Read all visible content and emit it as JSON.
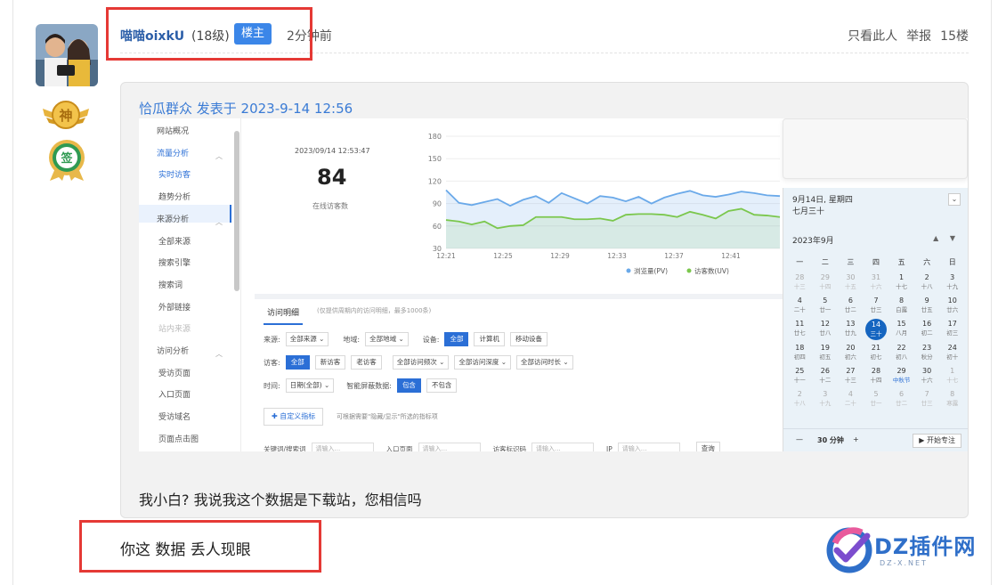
{
  "post": {
    "username": "喵喵oixkU",
    "level": "(18级)",
    "op_badge": "楼主",
    "time": "2分钟前",
    "actions": {
      "only_author": "只看此人",
      "report": "举报",
      "floor": "15楼"
    }
  },
  "quote": {
    "header": "恰瓜群众 发表于 2023-9-14 12:56",
    "text": "我小白? 我说我这个数据是下载站，您相信吗"
  },
  "reply": {
    "text": "你这 数据 丢人现眼"
  },
  "watermark": {
    "title": "DZ插件网",
    "sub": "DZ-X.NET"
  },
  "medals": {
    "shen": "神",
    "qian": "签"
  },
  "screenshot": {
    "sidebar": [
      {
        "label": "网站概况",
        "type": "top"
      },
      {
        "label": "流量分析",
        "type": "top-active"
      },
      {
        "label": "实时访客",
        "type": "sub-active"
      },
      {
        "label": "趋势分析",
        "type": "sub"
      },
      {
        "label": "来源分析",
        "type": "top"
      },
      {
        "label": "全部来源",
        "type": "sub"
      },
      {
        "label": "搜索引擎",
        "type": "sub"
      },
      {
        "label": "搜索词",
        "type": "sub"
      },
      {
        "label": "外部链接",
        "type": "sub"
      },
      {
        "label": "站内来源",
        "type": "sub-dim"
      },
      {
        "label": "访问分析",
        "type": "top"
      },
      {
        "label": "受访页面",
        "type": "sub"
      },
      {
        "label": "入口页面",
        "type": "sub"
      },
      {
        "label": "受访域名",
        "type": "sub"
      },
      {
        "label": "页面点击图",
        "type": "sub"
      }
    ],
    "stat": {
      "time": "2023/09/14 12:53:47",
      "value": "84",
      "label": "在线访客数"
    },
    "tabs": {
      "active": "访问明细",
      "note": "(仅提供周期内的访问明细，最多1000条)"
    },
    "filters": {
      "source_label": "来源:",
      "source_value": "全部来源",
      "region_label": "地域:",
      "region_value": "全部地域",
      "device_label": "设备:",
      "device_options": [
        "全部",
        "计算机",
        "移动设备"
      ],
      "visitor_label": "访客:",
      "visitor_options": [
        "全部",
        "新访客",
        "老访客"
      ],
      "freq_value": "全部访问频次",
      "depth_value": "全部访问深度",
      "duration_value": "全部访问时长",
      "time_label": "时间:",
      "time_value": "日期(全部)",
      "smart_label": "智能屏蔽数据:",
      "smart_options": [
        "包含",
        "不包含"
      ]
    },
    "custom_button": "自定义指标",
    "custom_note": "可根据需要\"隐藏/显示\"所选的指标项",
    "search": {
      "kw_label": "关键词/搜索词",
      "kw_ph": "请输入...",
      "entry_label": "入口页面",
      "entry_ph": "请输入...",
      "visitor_label": "访客标识码",
      "visitor_ph": "请输入...",
      "ip_label": "IP",
      "ip_ph": "请输入...",
      "query_btn": "查询"
    },
    "calendar": {
      "date_line": "9月14日, 星期四",
      "lunar_line": "七月三十",
      "month": "2023年9月",
      "weekdays": [
        "一",
        "二",
        "三",
        "四",
        "五",
        "六",
        "日"
      ],
      "days": [
        {
          "d": "28",
          "l": "十三",
          "o": true
        },
        {
          "d": "29",
          "l": "十四",
          "o": true
        },
        {
          "d": "30",
          "l": "十五",
          "o": true
        },
        {
          "d": "31",
          "l": "十六",
          "o": true
        },
        {
          "d": "1",
          "l": "十七"
        },
        {
          "d": "2",
          "l": "十八"
        },
        {
          "d": "3",
          "l": "十九"
        },
        {
          "d": "4",
          "l": "二十"
        },
        {
          "d": "5",
          "l": "廿一"
        },
        {
          "d": "6",
          "l": "廿二"
        },
        {
          "d": "7",
          "l": "廿三"
        },
        {
          "d": "8",
          "l": "白露"
        },
        {
          "d": "9",
          "l": "廿五"
        },
        {
          "d": "10",
          "l": "廿六"
        },
        {
          "d": "11",
          "l": "廿七"
        },
        {
          "d": "12",
          "l": "廿八"
        },
        {
          "d": "13",
          "l": "廿九"
        },
        {
          "d": "14",
          "l": "三十",
          "t": true
        },
        {
          "d": "15",
          "l": "八月"
        },
        {
          "d": "16",
          "l": "初二"
        },
        {
          "d": "17",
          "l": "初三"
        },
        {
          "d": "18",
          "l": "初四"
        },
        {
          "d": "19",
          "l": "初五"
        },
        {
          "d": "20",
          "l": "初六"
        },
        {
          "d": "21",
          "l": "初七"
        },
        {
          "d": "22",
          "l": "初八"
        },
        {
          "d": "23",
          "l": "秋分"
        },
        {
          "d": "24",
          "l": "初十"
        },
        {
          "d": "25",
          "l": "十一"
        },
        {
          "d": "26",
          "l": "十二"
        },
        {
          "d": "27",
          "l": "十三"
        },
        {
          "d": "28",
          "l": "十四"
        },
        {
          "d": "29",
          "l": "中秋节",
          "h": true
        },
        {
          "d": "30",
          "l": "十六"
        },
        {
          "d": "1",
          "l": "十七",
          "o": true
        },
        {
          "d": "2",
          "l": "十八",
          "o": true
        },
        {
          "d": "3",
          "l": "十九",
          "o": true
        },
        {
          "d": "4",
          "l": "二十",
          "o": true
        },
        {
          "d": "5",
          "l": "廿一",
          "o": true
        },
        {
          "d": "6",
          "l": "廿二",
          "o": true
        },
        {
          "d": "7",
          "l": "廿三",
          "o": true
        },
        {
          "d": "8",
          "l": "寒露",
          "o": true
        }
      ],
      "focus_minus": "—",
      "focus_value": "30 分钟",
      "focus_plus": "+",
      "focus_button": "▶ 开始专注"
    }
  },
  "chart_data": {
    "type": "area",
    "x": [
      "12:21",
      "12:25",
      "12:29",
      "12:33",
      "12:37",
      "12:41"
    ],
    "ylim": [
      30,
      180
    ],
    "yticks": [
      30,
      60,
      90,
      120,
      150,
      180
    ],
    "legend_placement": "bottom",
    "series": [
      {
        "name": "浏览量(PV)",
        "color": "#6aa9e9",
        "values": [
          108,
          91,
          88,
          92,
          96,
          87,
          95,
          100,
          91,
          104,
          97,
          90,
          100,
          98,
          93,
          99,
          90,
          98,
          103,
          107,
          101,
          99,
          102,
          106,
          104,
          101,
          100
        ]
      },
      {
        "name": "访客数(UV)",
        "color": "#7bc74d",
        "values": [
          68,
          66,
          62,
          66,
          57,
          60,
          61,
          72,
          72,
          72,
          69,
          69,
          70,
          67,
          75,
          76,
          76,
          75,
          72,
          79,
          75,
          70,
          80,
          83,
          75,
          74,
          72
        ]
      }
    ]
  }
}
